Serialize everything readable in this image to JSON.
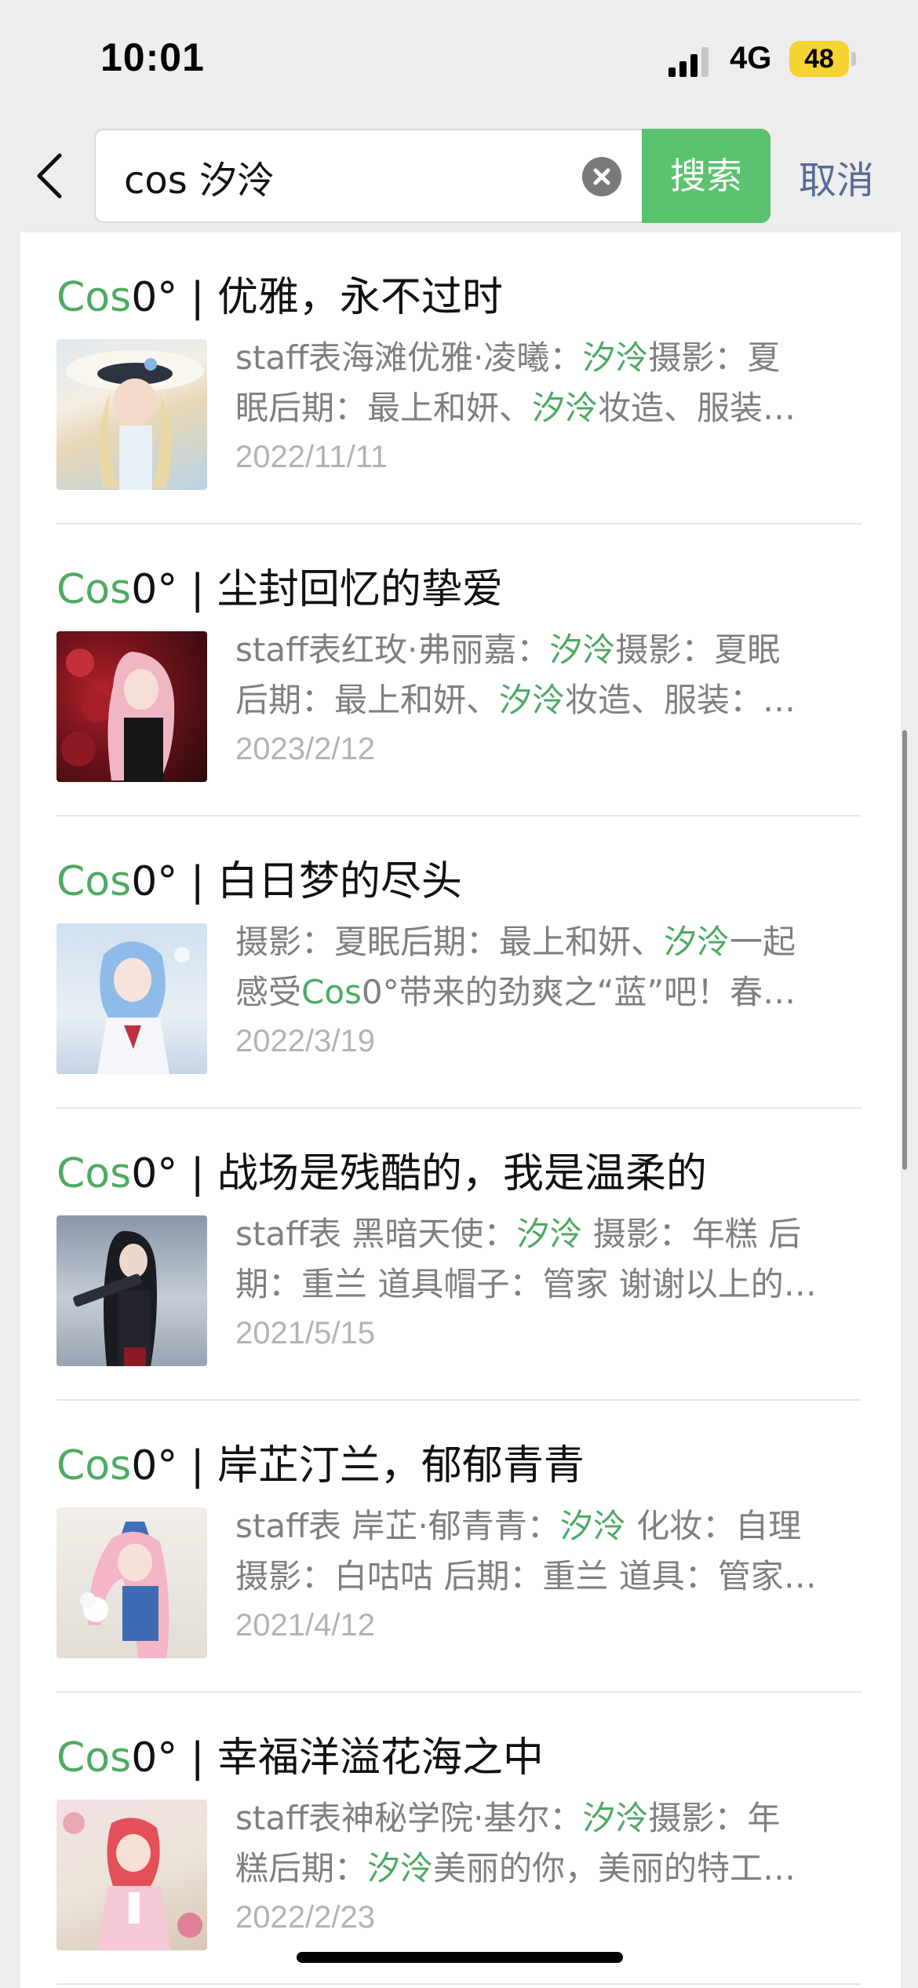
{
  "status_bar": {
    "time": "10:01",
    "network": "4G",
    "battery": "48"
  },
  "search": {
    "query": "cos 汐泠",
    "search_label": "搜索",
    "cancel_label": "取消"
  },
  "colors": {
    "highlight": "#4eaa62",
    "search_button": "#5ac26e",
    "link_blue": "#576b95"
  },
  "results": [
    {
      "title_prefix": "Cos",
      "title_rest": "0° | 优雅，永不过时",
      "line1_a": "staff表海滩优雅·凌曦：",
      "line1_hl": "汐泠",
      "line1_b": "摄影：夏",
      "line2_a": "眠后期：最上和妍、",
      "line2_hl": "汐泠",
      "line2_b": "妆造、服装…",
      "date": "2022/11/11"
    },
    {
      "title_prefix": "Cos",
      "title_rest": "0° | 尘封回忆的挚爱",
      "line1_a": "staff表红玫·弗丽嘉：",
      "line1_hl": "汐泠",
      "line1_b": "摄影：夏眠",
      "line2_a": "后期：最上和妍、",
      "line2_hl": "汐泠",
      "line2_b": "妆造、服装：…",
      "date": "2023/2/12"
    },
    {
      "title_prefix": "Cos",
      "title_rest": "0° | 白日梦的尽头",
      "line1_a": "摄影：夏眠后期：最上和妍、",
      "line1_hl": "汐泠",
      "line1_b": "一起",
      "line2_a": "感受",
      "line2_hl": "Cos",
      "line2_b": "0°带来的劲爽之“蓝”吧！春…",
      "date": "2022/3/19"
    },
    {
      "title_prefix": "Cos",
      "title_rest": "0° | 战场是残酷的，我是温柔的",
      "line1_a": "staff表 黑暗天使：",
      "line1_hl": "汐泠",
      "line1_b": " 摄影：年糕 后",
      "line2_a": "期：重兰 道具帽子：管家 谢谢以上的…",
      "line2_hl": "",
      "line2_b": "",
      "date": "2021/5/15"
    },
    {
      "title_prefix": "Cos",
      "title_rest": "0° | 岸芷汀兰，郁郁青青",
      "line1_a": "staff表 岸芷·郁青青：",
      "line1_hl": "汐泠",
      "line1_b": " 化妆：自理",
      "line2_a": "摄影：白咕咕 后期：重兰 道具：管家…",
      "line2_hl": "",
      "line2_b": "",
      "date": "2021/4/12"
    },
    {
      "title_prefix": "Cos",
      "title_rest": "0° | 幸福洋溢花海之中",
      "line1_a": "staff表神秘学院·基尔：",
      "line1_hl": "汐泠",
      "line1_b": "摄影：年",
      "line2_a": "糕后期：",
      "line2_hl": "汐泠",
      "line2_b": "美丽的你，美丽的特工…",
      "date": "2022/2/23"
    }
  ]
}
